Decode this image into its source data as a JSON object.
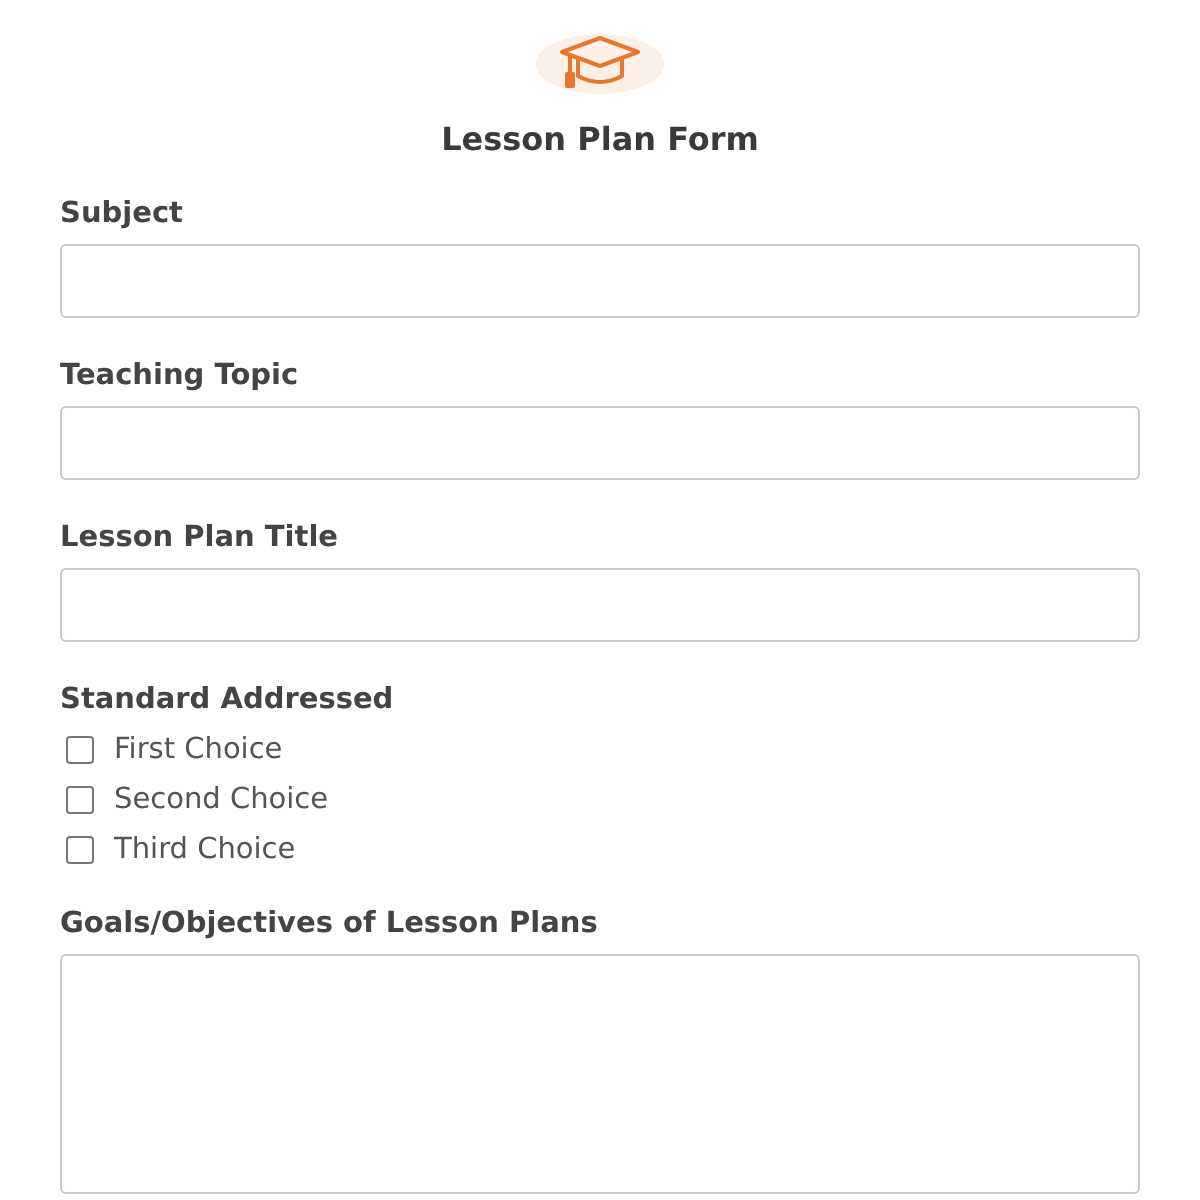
{
  "title": "Lesson Plan Form",
  "fields": [
    {
      "kind": "text",
      "label": "Subject"
    },
    {
      "kind": "text",
      "label": "Teaching Topic"
    },
    {
      "kind": "text",
      "label": "Lesson Plan Title"
    },
    {
      "kind": "checkboxes",
      "label": "Standard Addressed",
      "options": [
        {
          "label": "First Choice",
          "checked": false
        },
        {
          "label": "Second Choice",
          "checked": false
        },
        {
          "label": "Third Choice",
          "checked": false
        }
      ]
    },
    {
      "kind": "textarea",
      "label": "Goals/Objectives of Lesson Plans"
    }
  ]
}
